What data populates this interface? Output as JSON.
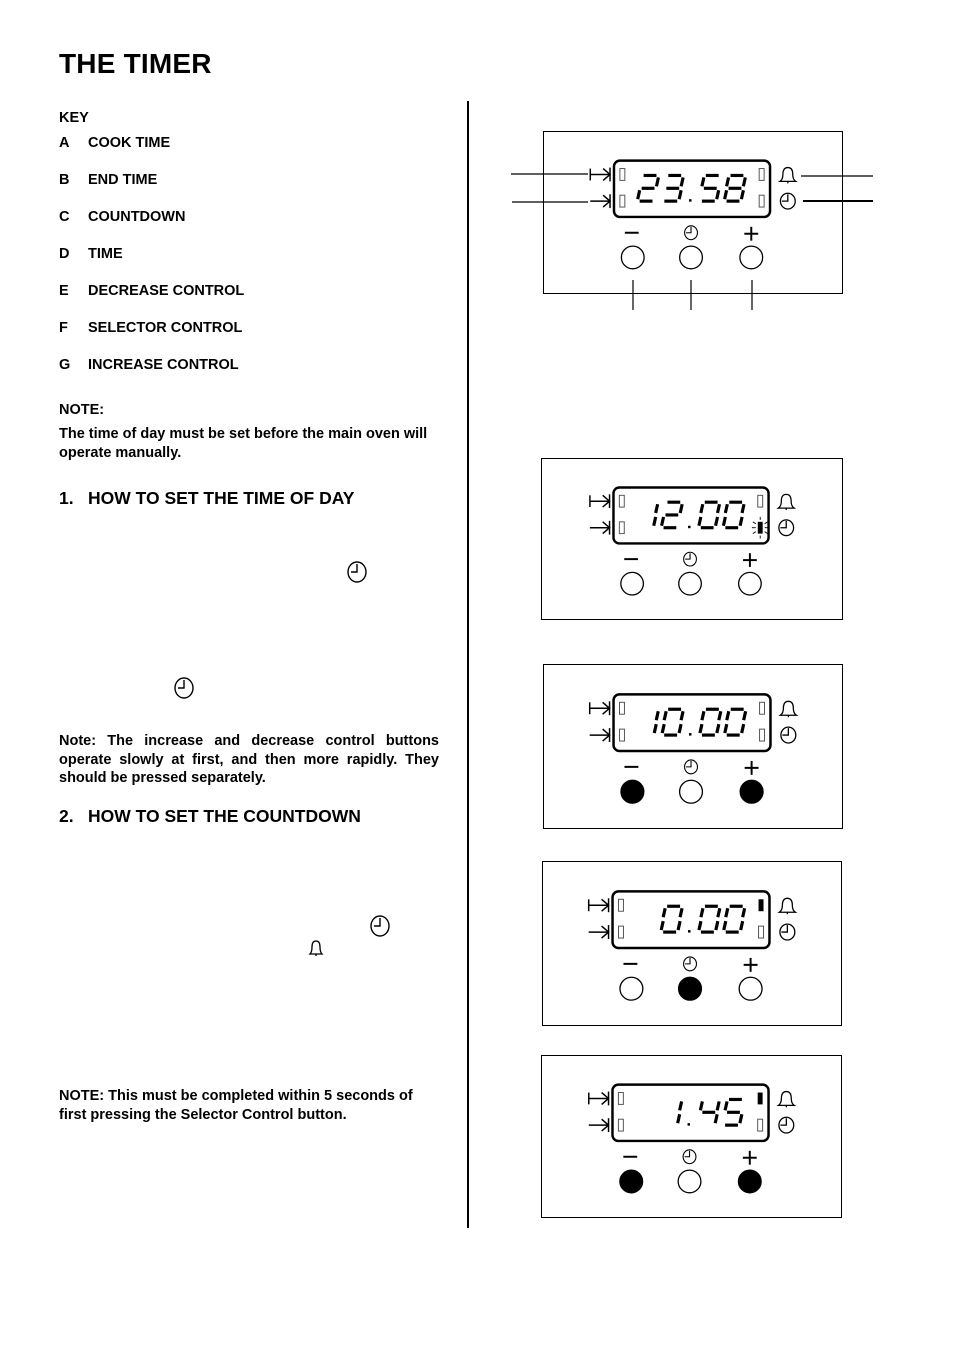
{
  "page": {
    "title": "THE TIMER"
  },
  "key": {
    "heading": "KEY",
    "items": [
      {
        "letter": "A",
        "label": "COOK TIME"
      },
      {
        "letter": "B",
        "label": "END TIME"
      },
      {
        "letter": "C",
        "label": "COUNTDOWN"
      },
      {
        "letter": "D",
        "label": "TIME"
      },
      {
        "letter": "E",
        "label": "DECREASE CONTROL"
      },
      {
        "letter": "F",
        "label": "SELECTOR CONTROL"
      },
      {
        "letter": "G",
        "label": "INCREASE CONTROL"
      }
    ]
  },
  "note": {
    "heading": "NOTE:",
    "text": "The time of day must be set before the main oven will operate manually."
  },
  "section1": {
    "number": "1.",
    "heading": "HOW TO SET THE TIME OF DAY",
    "inline_icons": [
      "clock-icon",
      "clock-icon"
    ],
    "note": "Note: The increase and decrease control buttons operate slowly at first, and then more rapidly. They should be pressed separately."
  },
  "section2": {
    "number": "2.",
    "heading": "HOW TO SET THE COUNTDOWN",
    "inline_icons": [
      "clock-icon",
      "bell-icon"
    ],
    "note": "NOTE:  This must be completed within 5 seconds of first pressing the Selector Control button."
  },
  "panels": [
    {
      "id": "overview",
      "display": "23.58",
      "leader_lines": true,
      "indicators": {
        "cook_time": "off",
        "end_time": "off",
        "countdown": "off",
        "time": "off"
      },
      "buttons": {
        "decrease": "released",
        "selector": "released",
        "increase": "released"
      }
    },
    {
      "id": "set-time-of-day",
      "display": "12.00",
      "leader_lines": false,
      "indicators": {
        "cook_time": "off",
        "end_time": "off",
        "countdown": "off",
        "time": "flashing"
      },
      "buttons": {
        "decrease": "released",
        "selector": "released",
        "increase": "released"
      }
    },
    {
      "id": "adjust-time",
      "display": "10.00",
      "leader_lines": false,
      "indicators": {
        "cook_time": "off",
        "end_time": "off",
        "countdown": "off",
        "time": "off"
      },
      "buttons": {
        "decrease": "pressed",
        "selector": "released",
        "increase": "pressed"
      }
    },
    {
      "id": "select-countdown",
      "display": "0.00",
      "leader_lines": false,
      "indicators": {
        "cook_time": "off",
        "end_time": "off",
        "countdown": "on",
        "time": "off"
      },
      "buttons": {
        "decrease": "released",
        "selector": "pressed",
        "increase": "released"
      }
    },
    {
      "id": "set-countdown",
      "display": "1.45",
      "leader_lines": false,
      "indicators": {
        "cook_time": "off",
        "end_time": "off",
        "countdown": "on",
        "time": "off"
      },
      "buttons": {
        "decrease": "pressed",
        "selector": "released",
        "increase": "pressed"
      }
    }
  ],
  "button_symbols": {
    "decrease": "−",
    "increase": "+"
  }
}
